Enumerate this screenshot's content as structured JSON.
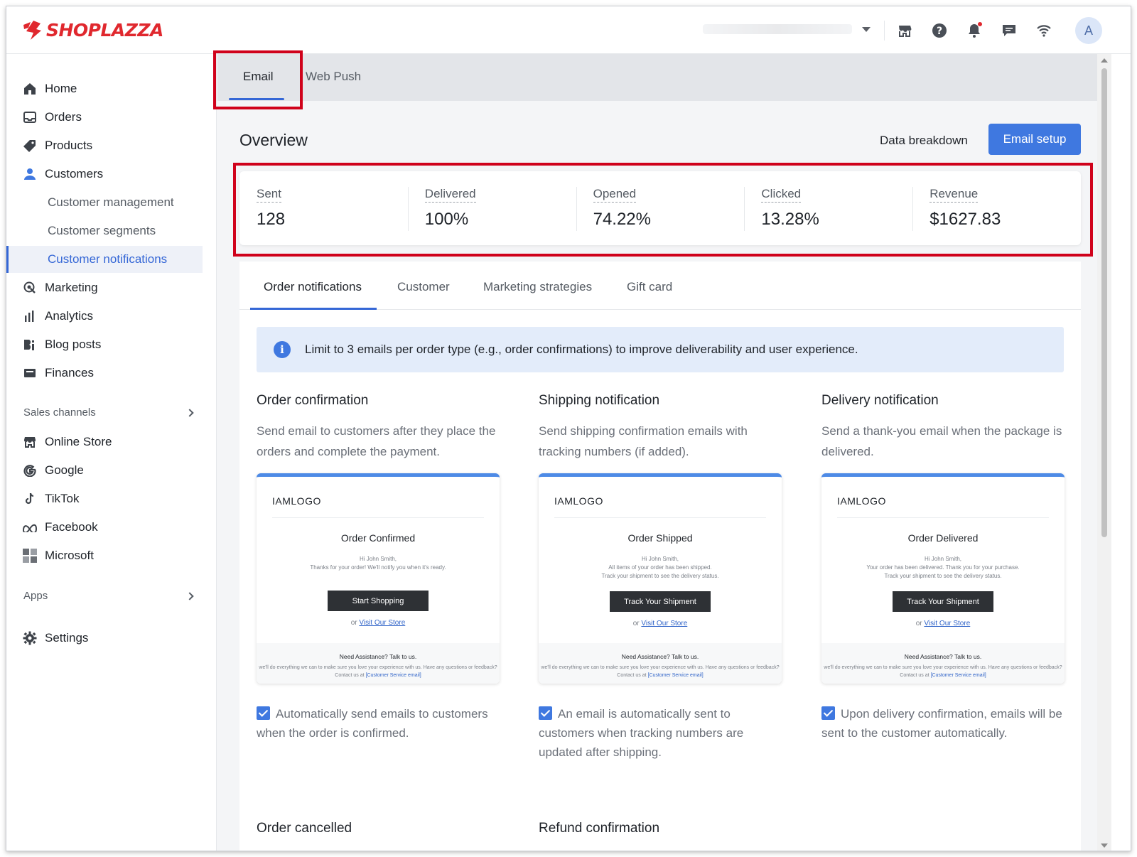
{
  "brand": {
    "name": "SHOPLAZZA",
    "color": "#e0282e",
    "accent": "#3f78e0",
    "highlight": "#d0021b"
  },
  "topbar": {
    "icons": [
      "store-icon",
      "help-icon",
      "bell-icon",
      "chat-icon",
      "wifi-icon"
    ],
    "avatar": "A"
  },
  "sidebar": {
    "items": [
      {
        "label": "Home",
        "icon": "home-icon"
      },
      {
        "label": "Orders",
        "icon": "inbox-icon"
      },
      {
        "label": "Products",
        "icon": "tag-icon"
      },
      {
        "label": "Customers",
        "icon": "person-icon"
      }
    ],
    "customer_sub": [
      "Customer management",
      "Customer segments",
      "Customer notifications"
    ],
    "items2": [
      {
        "label": "Marketing",
        "icon": "marketing-icon"
      },
      {
        "label": "Analytics",
        "icon": "bar-chart-icon"
      },
      {
        "label": "Blog posts",
        "icon": "blog-icon"
      },
      {
        "label": "Finances",
        "icon": "finance-icon"
      }
    ],
    "sales_channels_label": "Sales channels",
    "channels": [
      {
        "label": "Online Store",
        "icon": "store-icon"
      },
      {
        "label": "Google",
        "icon": "google-icon"
      },
      {
        "label": "TikTok",
        "icon": "tiktok-icon"
      },
      {
        "label": "Facebook",
        "icon": "meta-icon"
      },
      {
        "label": "Microsoft",
        "icon": "microsoft-icon"
      }
    ],
    "apps_label": "Apps",
    "settings_label": "Settings"
  },
  "top_tabs": [
    "Email",
    "Web Push"
  ],
  "overview": {
    "title": "Overview",
    "data_breakdown": "Data breakdown",
    "email_setup": "Email setup",
    "stats": [
      {
        "label": "Sent",
        "value": "128"
      },
      {
        "label": "Delivered",
        "value": "100%"
      },
      {
        "label": "Opened",
        "value": "74.22%"
      },
      {
        "label": "Clicked",
        "value": "13.28%"
      },
      {
        "label": "Revenue",
        "value": "$1627.83"
      }
    ]
  },
  "notif_tabs": [
    "Order notifications",
    "Customer",
    "Marketing strategies",
    "Gift card"
  ],
  "info_banner": "Limit to 3 emails per order type (e.g., order confirmations) to improve deliverability and user experience.",
  "cards": [
    {
      "title": "Order confirmation",
      "desc": "Send email to customers after they place the orders and complete the payment.",
      "preview": {
        "logo": "IAMLOGO",
        "heading": "Order Confirmed",
        "lines": [
          "Hi John Smith,",
          "Thanks for your order! We'll notify you when it's ready."
        ],
        "button": "Start Shopping",
        "or": "or",
        "link": "Visit Our Store",
        "foot_heading": "Need Assistance? Talk to us.",
        "foot_text": "we'll do everything we can to make sure you love your experience with us. Have any questions or feedback? Contact us at",
        "foot_link": "[Customer Service email]"
      },
      "check_label": "Automatically send emails to customers when the order is confirmed."
    },
    {
      "title": "Shipping notification",
      "desc": "Send shipping confirmation emails with tracking numbers (if added).",
      "preview": {
        "logo": "IAMLOGO",
        "heading": "Order Shipped",
        "lines": [
          "Hi John Smith,",
          "All items of your order has been shipped.",
          "Track your shipment to see the delivery status."
        ],
        "button": "Track Your Shipment",
        "or": "or",
        "link": "Visit Our Store",
        "foot_heading": "Need Assistance? Talk to us.",
        "foot_text": "we'll do everything we can to make sure you love your experience with us. Have any questions or feedback? Contact us at",
        "foot_link": "[Customer Service email]"
      },
      "check_label": "An email is automatically sent to customers when tracking numbers are updated after shipping."
    },
    {
      "title": "Delivery notification",
      "desc": "Send a thank-you email when the package is delivered.",
      "preview": {
        "logo": "IAMLOGO",
        "heading": "Order Delivered",
        "lines": [
          "Hi John Smith,",
          "Your order has been delivered. Thank you for your purchase.",
          "Track your shipment to see the delivery status."
        ],
        "button": "Track Your Shipment",
        "or": "or",
        "link": "Visit Our Store",
        "foot_heading": "Need Assistance? Talk to us.",
        "foot_text": "we'll do everything we can to make sure you love your experience with us. Have any questions or feedback? Contact us at",
        "foot_link": "[Customer Service email]"
      },
      "check_label": "Upon delivery confirmation, emails will be sent to the customer automatically."
    }
  ],
  "more_cards": [
    "Order cancelled",
    "Refund confirmation"
  ]
}
